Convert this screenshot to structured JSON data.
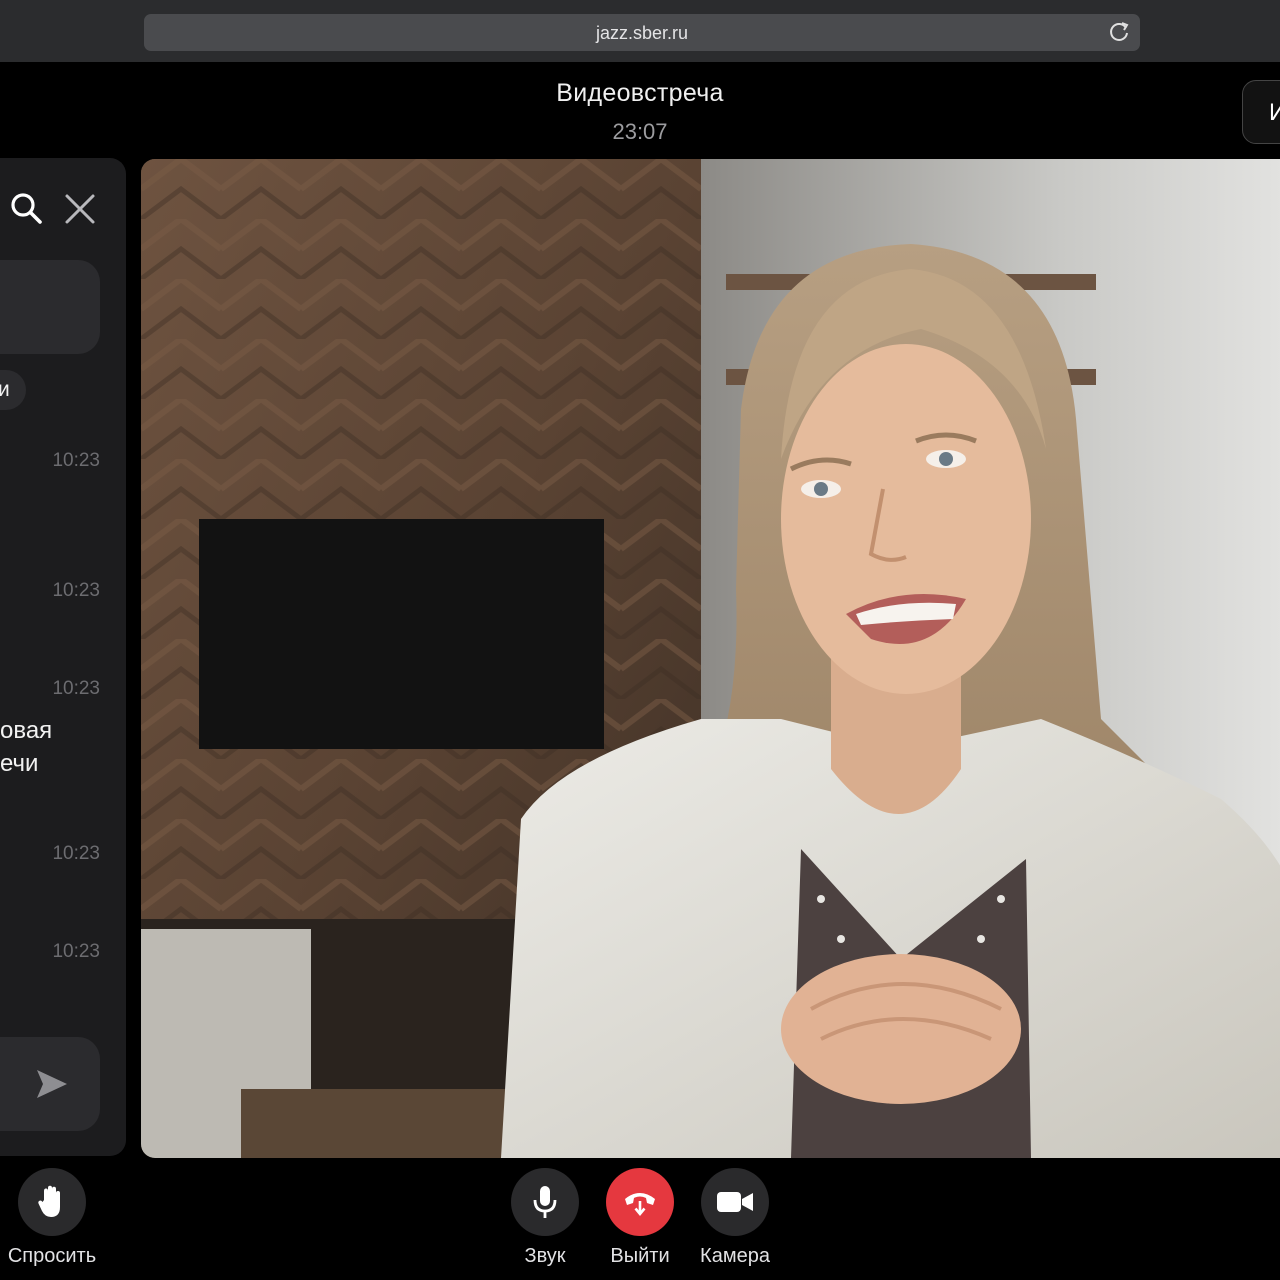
{
  "browser": {
    "url": "jazz.sber.ru"
  },
  "header": {
    "title": "Видеовстреча",
    "time": "23:07",
    "right_button_label": "И"
  },
  "chat": {
    "pill_text": "и",
    "messages": [
      {
        "time": "10:23"
      },
      {
        "time": "10:23"
      },
      {
        "time": "10:23",
        "text_line1": "овая",
        "text_line2": "ечи"
      },
      {
        "time": "10:23"
      },
      {
        "time": "10:23"
      }
    ]
  },
  "controls": {
    "ask": "Спросить",
    "sound": "Звук",
    "leave": "Выйти",
    "camera": "Камера"
  },
  "colors": {
    "leave_button": "#e5383f",
    "panel": "#1c1c1e",
    "background": "#000000"
  }
}
